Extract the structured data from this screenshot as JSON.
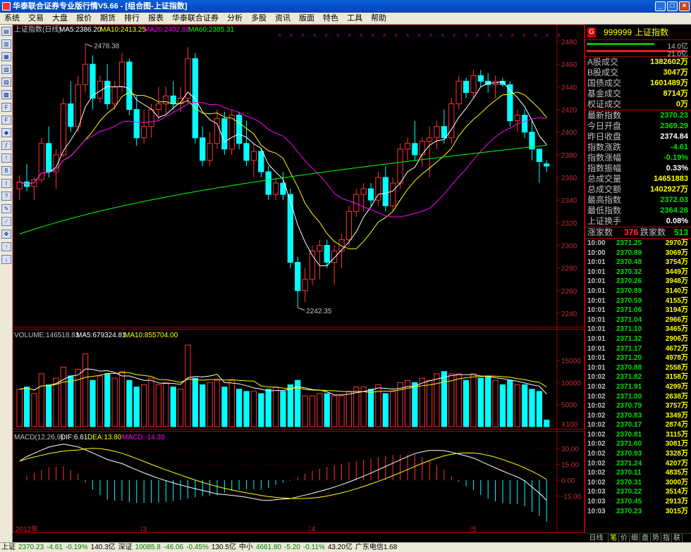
{
  "window": {
    "title": "华泰联合证券专业版行情V5.66 - [组合图-上证指数]"
  },
  "menu": [
    "系统",
    "交易",
    "大盘",
    "报价",
    "期货",
    "排行",
    "报表",
    "华泰联合证券",
    "分析",
    "多股",
    "资讯",
    "版面",
    "特色",
    "工具",
    "帮助"
  ],
  "toolbar_icons": [
    "line-chart-icon",
    "bar-chart-icon",
    "candle-icon",
    "table-icon",
    "grid-icon",
    "news-icon",
    "f10-icon",
    "f10b-icon",
    "select-stock-icon",
    "formula-icon",
    "alert-icon",
    "bsi-icon",
    "stock-info-icon",
    "question-icon",
    "tools-icon",
    "draw-icon",
    "arrows-icon",
    "up-icon",
    "down-icon"
  ],
  "header": {
    "price_panel": "上证指数(日线)",
    "ma5": "MA5:2386.20",
    "ma10": "MA10:2413.25",
    "ma20": "MA20:2402.88",
    "ma60": "MA60:2385.31",
    "volume": "VOLUME:146518.83",
    "vma5": "MA5:679324.81",
    "vma10": "MA10:855704.00",
    "macd": "MACD(12,26,9)",
    "dif": "DIF:6.61",
    "dea": "DEA:13.80",
    "macdv": "MACD:-14.39",
    "high_label": "2478.38",
    "low_label": "2242.35",
    "x100": "X100",
    "year_label": "2012年",
    "month_labels": [
      "3",
      "4",
      "5"
    ]
  },
  "chart_data": {
    "type": "candlestick",
    "ylim": [
      2230,
      2490
    ],
    "y_ticks": [
      2240,
      2260,
      2280,
      2300,
      2320,
      2340,
      2360,
      2380,
      2400,
      2420,
      2440,
      2460,
      2480
    ],
    "vol_ticks": [
      "5000",
      "10000",
      "15000"
    ],
    "macd_ticks": [
      "-15.00",
      "0.00",
      "15.00",
      "30.00"
    ],
    "ohlc": [
      [
        2350,
        2362,
        2340,
        2356
      ],
      [
        2356,
        2372,
        2348,
        2352
      ],
      [
        2352,
        2360,
        2340,
        2358
      ],
      [
        2358,
        2395,
        2355,
        2390
      ],
      [
        2390,
        2405,
        2360,
        2365
      ],
      [
        2365,
        2385,
        2350,
        2380
      ],
      [
        2380,
        2430,
        2378,
        2425
      ],
      [
        2425,
        2445,
        2400,
        2405
      ],
      [
        2405,
        2450,
        2400,
        2442
      ],
      [
        2442,
        2478,
        2435,
        2460
      ],
      [
        2460,
        2468,
        2420,
        2430
      ],
      [
        2430,
        2450,
        2426,
        2445
      ],
      [
        2445,
        2460,
        2420,
        2425
      ],
      [
        2425,
        2445,
        2420,
        2440
      ],
      [
        2440,
        2470,
        2435,
        2462
      ],
      [
        2462,
        2465,
        2415,
        2420
      ],
      [
        2420,
        2432,
        2388,
        2395
      ],
      [
        2395,
        2420,
        2390,
        2405
      ],
      [
        2405,
        2425,
        2395,
        2420
      ],
      [
        2420,
        2440,
        2410,
        2425
      ],
      [
        2425,
        2440,
        2415,
        2432
      ],
      [
        2432,
        2445,
        2420,
        2425
      ],
      [
        2425,
        2440,
        2418,
        2430
      ],
      [
        2430,
        2475,
        2425,
        2465
      ],
      [
        2465,
        2470,
        2390,
        2395
      ],
      [
        2395,
        2405,
        2370,
        2375
      ],
      [
        2375,
        2400,
        2370,
        2390
      ],
      [
        2390,
        2420,
        2385,
        2412
      ],
      [
        2412,
        2418,
        2380,
        2385
      ],
      [
        2385,
        2420,
        2380,
        2415
      ],
      [
        2415,
        2418,
        2385,
        2390
      ],
      [
        2390,
        2410,
        2370,
        2375
      ],
      [
        2375,
        2390,
        2360,
        2383
      ],
      [
        2383,
        2386,
        2360,
        2365
      ],
      [
        2365,
        2370,
        2340,
        2345
      ],
      [
        2345,
        2360,
        2340,
        2355
      ],
      [
        2355,
        2365,
        2340,
        2345
      ],
      [
        2345,
        2350,
        2280,
        2285
      ],
      [
        2285,
        2290,
        2245,
        2260
      ],
      [
        2260,
        2280,
        2250,
        2270
      ],
      [
        2270,
        2300,
        2265,
        2295
      ],
      [
        2295,
        2305,
        2270,
        2300
      ],
      [
        2300,
        2305,
        2280,
        2285
      ],
      [
        2285,
        2300,
        2265,
        2295
      ],
      [
        2295,
        2310,
        2280,
        2305
      ],
      [
        2305,
        2335,
        2300,
        2330
      ],
      [
        2330,
        2350,
        2325,
        2345
      ],
      [
        2345,
        2355,
        2330,
        2350
      ],
      [
        2350,
        2355,
        2335,
        2340
      ],
      [
        2340,
        2365,
        2335,
        2360
      ],
      [
        2360,
        2370,
        2330,
        2335
      ],
      [
        2335,
        2360,
        2330,
        2355
      ],
      [
        2355,
        2390,
        2350,
        2385
      ],
      [
        2385,
        2395,
        2375,
        2390
      ],
      [
        2390,
        2410,
        2375,
        2380
      ],
      [
        2380,
        2395,
        2370,
        2392
      ],
      [
        2392,
        2405,
        2360,
        2395
      ],
      [
        2395,
        2410,
        2385,
        2405
      ],
      [
        2405,
        2420,
        2390,
        2395
      ],
      [
        2395,
        2430,
        2390,
        2425
      ],
      [
        2425,
        2450,
        2420,
        2445
      ],
      [
        2445,
        2448,
        2430,
        2435
      ],
      [
        2435,
        2455,
        2430,
        2450
      ],
      [
        2450,
        2455,
        2440,
        2445
      ],
      [
        2445,
        2452,
        2435,
        2442
      ],
      [
        2442,
        2450,
        2430,
        2445
      ],
      [
        2445,
        2448,
        2440,
        2442
      ],
      [
        2442,
        2445,
        2405,
        2410
      ],
      [
        2410,
        2420,
        2400,
        2415
      ],
      [
        2415,
        2420,
        2395,
        2400
      ],
      [
        2400,
        2410,
        2375,
        2385
      ],
      [
        2385,
        2375,
        2355,
        2374
      ],
      [
        2372,
        2375,
        2365,
        2370
      ]
    ],
    "volume": [
      8500,
      9000,
      7500,
      12000,
      9500,
      11000,
      13500,
      11500,
      13000,
      16500,
      10500,
      11500,
      12000,
      11000,
      12500,
      10500,
      9000,
      9500,
      11000,
      9500,
      10000,
      9000,
      8500,
      18500,
      11000,
      9500,
      10000,
      10500,
      9000,
      10500,
      8500,
      8000,
      8000,
      7500,
      8500,
      9000,
      8000,
      9500,
      10500,
      7000,
      7000,
      7500,
      7500,
      7000,
      7000,
      8000,
      9000,
      9000,
      8500,
      9500,
      7500,
      8000,
      10000,
      10500,
      10000,
      11000,
      10500,
      12000,
      12500,
      12000,
      12000,
      10500,
      12000,
      11000,
      11500,
      10500,
      9500,
      10500,
      9500,
      9500,
      8500,
      8000,
      1500
    ],
    "macd": [
      15,
      18,
      20,
      22,
      24,
      25,
      26,
      25,
      24,
      22,
      20,
      18,
      16,
      15,
      14,
      12,
      10,
      8,
      6,
      4,
      2,
      0,
      -2,
      -4,
      -6,
      -8,
      -10,
      -12,
      -13,
      -14,
      -15,
      -16,
      -17,
      -18,
      -18,
      -17,
      -16,
      -15,
      -13,
      -11,
      -9,
      -7,
      -5,
      -3,
      -1,
      1,
      3,
      5,
      7,
      9,
      11,
      13,
      15,
      17,
      19,
      20,
      21,
      21,
      21,
      20,
      19,
      18,
      17,
      15,
      13,
      11,
      9,
      7,
      5,
      2,
      -3,
      -8,
      -14
    ]
  },
  "right_panel": {
    "g_badge": "G",
    "code": "999999",
    "name": "上证指数",
    "bar1_val": "14.0亿",
    "bar2_val": "21.0亿",
    "stats": [
      {
        "k": "A股成交",
        "v": "1382602万",
        "c": "#ffff00"
      },
      {
        "k": "B股成交",
        "v": "3047万",
        "c": "#ffff00"
      },
      {
        "k": "国债成交",
        "v": "1601489万",
        "c": "#ffff00"
      },
      {
        "k": "基金成交",
        "v": "8714万",
        "c": "#ffff00"
      },
      {
        "k": "权证成交",
        "v": "0万",
        "c": "#ffff00"
      }
    ],
    "quotes": [
      {
        "k": "最新指数",
        "v": "2370.23",
        "c": "#00e000"
      },
      {
        "k": "今日开盘",
        "v": "2369.29",
        "c": "#00e000"
      },
      {
        "k": "昨日收盘",
        "v": "2374.84",
        "c": "#ffffff"
      },
      {
        "k": "指数涨跌",
        "v": "-4.61",
        "c": "#00e000"
      },
      {
        "k": "指数涨幅",
        "v": "-0.19%",
        "c": "#00e000"
      },
      {
        "k": "指数振幅",
        "v": "0.33%",
        "c": "#ffffff"
      },
      {
        "k": "总成交量",
        "v": "14651883",
        "c": "#ffff00"
      },
      {
        "k": "总成交额",
        "v": "1402927万",
        "c": "#ffff00"
      },
      {
        "k": "最高指数",
        "v": "2372.03",
        "c": "#00e000"
      },
      {
        "k": "最低指数",
        "v": "2364.28",
        "c": "#00e000"
      },
      {
        "k": "上证换手",
        "v": "0.08%",
        "c": "#ffffff"
      }
    ],
    "zhang_label": "涨家数",
    "zhang_val": "376",
    "die_label": "跌家数",
    "die_val": "513",
    "ticks": [
      {
        "t": "10:00",
        "p": "2371.25",
        "v": "2970万"
      },
      {
        "t": "10:00",
        "p": "2370.89",
        "v": "3069万"
      },
      {
        "t": "10:01",
        "p": "2370.48",
        "v": "3754万"
      },
      {
        "t": "10:01",
        "p": "2370.32",
        "v": "3449万"
      },
      {
        "t": "10:01",
        "p": "2370.26",
        "v": "3948万"
      },
      {
        "t": "10:01",
        "p": "2370.89",
        "v": "3140万"
      },
      {
        "t": "10:01",
        "p": "2370.59",
        "v": "4155万"
      },
      {
        "t": "10:01",
        "p": "2371.06",
        "v": "3194万"
      },
      {
        "t": "10:01",
        "p": "2371.04",
        "v": "2966万"
      },
      {
        "t": "10:01",
        "p": "2371.10",
        "v": "3465万"
      },
      {
        "t": "10:01",
        "p": "2371.32",
        "v": "2906万"
      },
      {
        "t": "10:01",
        "p": "2371.17",
        "v": "4672万"
      },
      {
        "t": "10:01",
        "p": "2371.20",
        "v": "4978万"
      },
      {
        "t": "10:01",
        "p": "2370.88",
        "v": "2558万"
      },
      {
        "t": "10:02",
        "p": "2371.82",
        "v": "3158万"
      },
      {
        "t": "10:02",
        "p": "2371.91",
        "v": "4299万"
      },
      {
        "t": "10:02",
        "p": "2371.00",
        "v": "2638万"
      },
      {
        "t": "10:02",
        "p": "2370.79",
        "v": "3757万"
      },
      {
        "t": "10:02",
        "p": "2370.83",
        "v": "3349万"
      },
      {
        "t": "10:02",
        "p": "2370.17",
        "v": "2874万"
      },
      {
        "t": "10:02",
        "p": "2370.81",
        "v": "3115万"
      },
      {
        "t": "10:02",
        "p": "2371.60",
        "v": "3081万"
      },
      {
        "t": "10:02",
        "p": "2370.93",
        "v": "3328万"
      },
      {
        "t": "10:02",
        "p": "2371.24",
        "v": "4207万"
      },
      {
        "t": "10:02",
        "p": "2370.11",
        "v": "4835万"
      },
      {
        "t": "10:02",
        "p": "2370.31",
        "v": "3000万"
      },
      {
        "t": "10:03",
        "p": "2370.22",
        "v": "3514万"
      },
      {
        "t": "10:03",
        "p": "2370.45",
        "v": "2913万"
      },
      {
        "t": "10:03",
        "p": "2370.23",
        "v": "3015万"
      }
    ],
    "tabs": [
      "笔",
      "价",
      "细",
      "盘",
      "势",
      "指",
      "联",
      "值"
    ],
    "tab_left": "日线"
  },
  "status": {
    "items": [
      {
        "t": "上证",
        "c": "#000"
      },
      {
        "t": "2370.23",
        "c": "#008000"
      },
      {
        "t": "-4.61",
        "c": "#008000"
      },
      {
        "t": "-0.19%",
        "c": "#008000"
      },
      {
        "t": "140.3亿",
        "c": "#000"
      },
      {
        "t": "深证",
        "c": "#000"
      },
      {
        "t": "10085.8",
        "c": "#008000"
      },
      {
        "t": "-46.06",
        "c": "#008000"
      },
      {
        "t": "-0.45%",
        "c": "#008000"
      },
      {
        "t": "130.5亿",
        "c": "#000"
      },
      {
        "t": "中小",
        "c": "#000"
      },
      {
        "t": "4661.80",
        "c": "#008000"
      },
      {
        "t": "-5.20",
        "c": "#008000"
      },
      {
        "t": "-0.11%",
        "c": "#008000"
      },
      {
        "t": "43.20亿",
        "c": "#000"
      },
      {
        "t": "广东电信1.68",
        "c": "#000"
      }
    ]
  }
}
